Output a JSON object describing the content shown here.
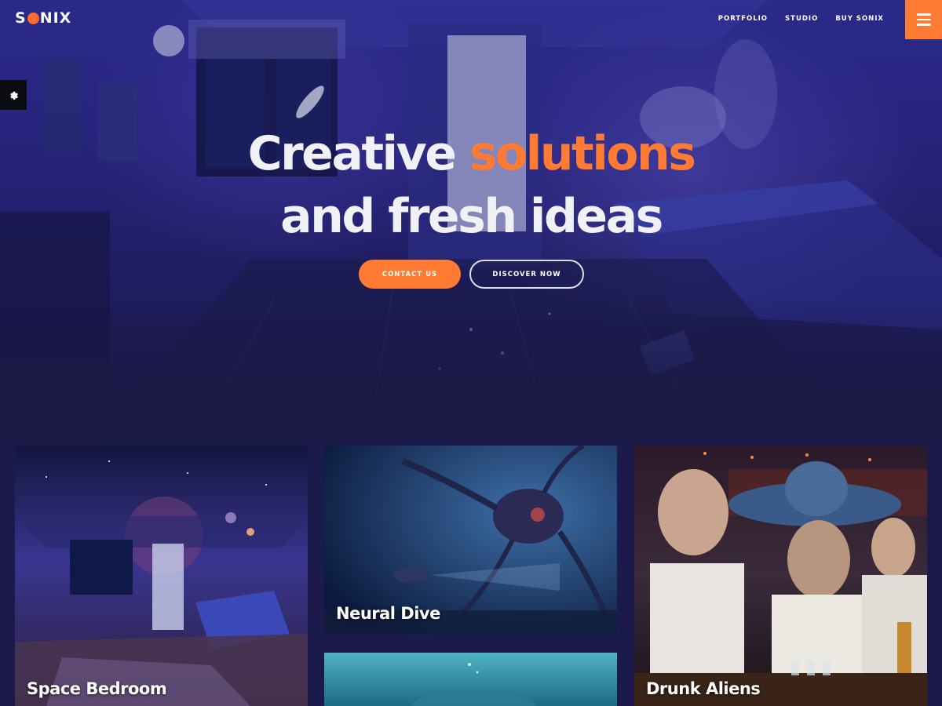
{
  "brand": {
    "logo_prefix": "S",
    "logo_suffix": "NIX",
    "accent_color": "#ff7a33"
  },
  "nav": {
    "items": [
      "PORTFOLIO",
      "STUDIO",
      "BUY SONIX"
    ]
  },
  "hero": {
    "line1_plain": "Creative",
    "line1_accent": "solutions",
    "line2": "and fresh ideas",
    "contact_label": "CONTACT US",
    "discover_label": "DISCOVER NOW"
  },
  "portfolio": [
    {
      "title": "Space Bedroom"
    },
    {
      "title": "Neural Dive"
    },
    {
      "title": ""
    },
    {
      "title": "Drunk Aliens"
    }
  ],
  "icons": {
    "menu": "hamburger-icon",
    "settings": "gear-icon",
    "logo_o": "orange-dot-icon"
  }
}
